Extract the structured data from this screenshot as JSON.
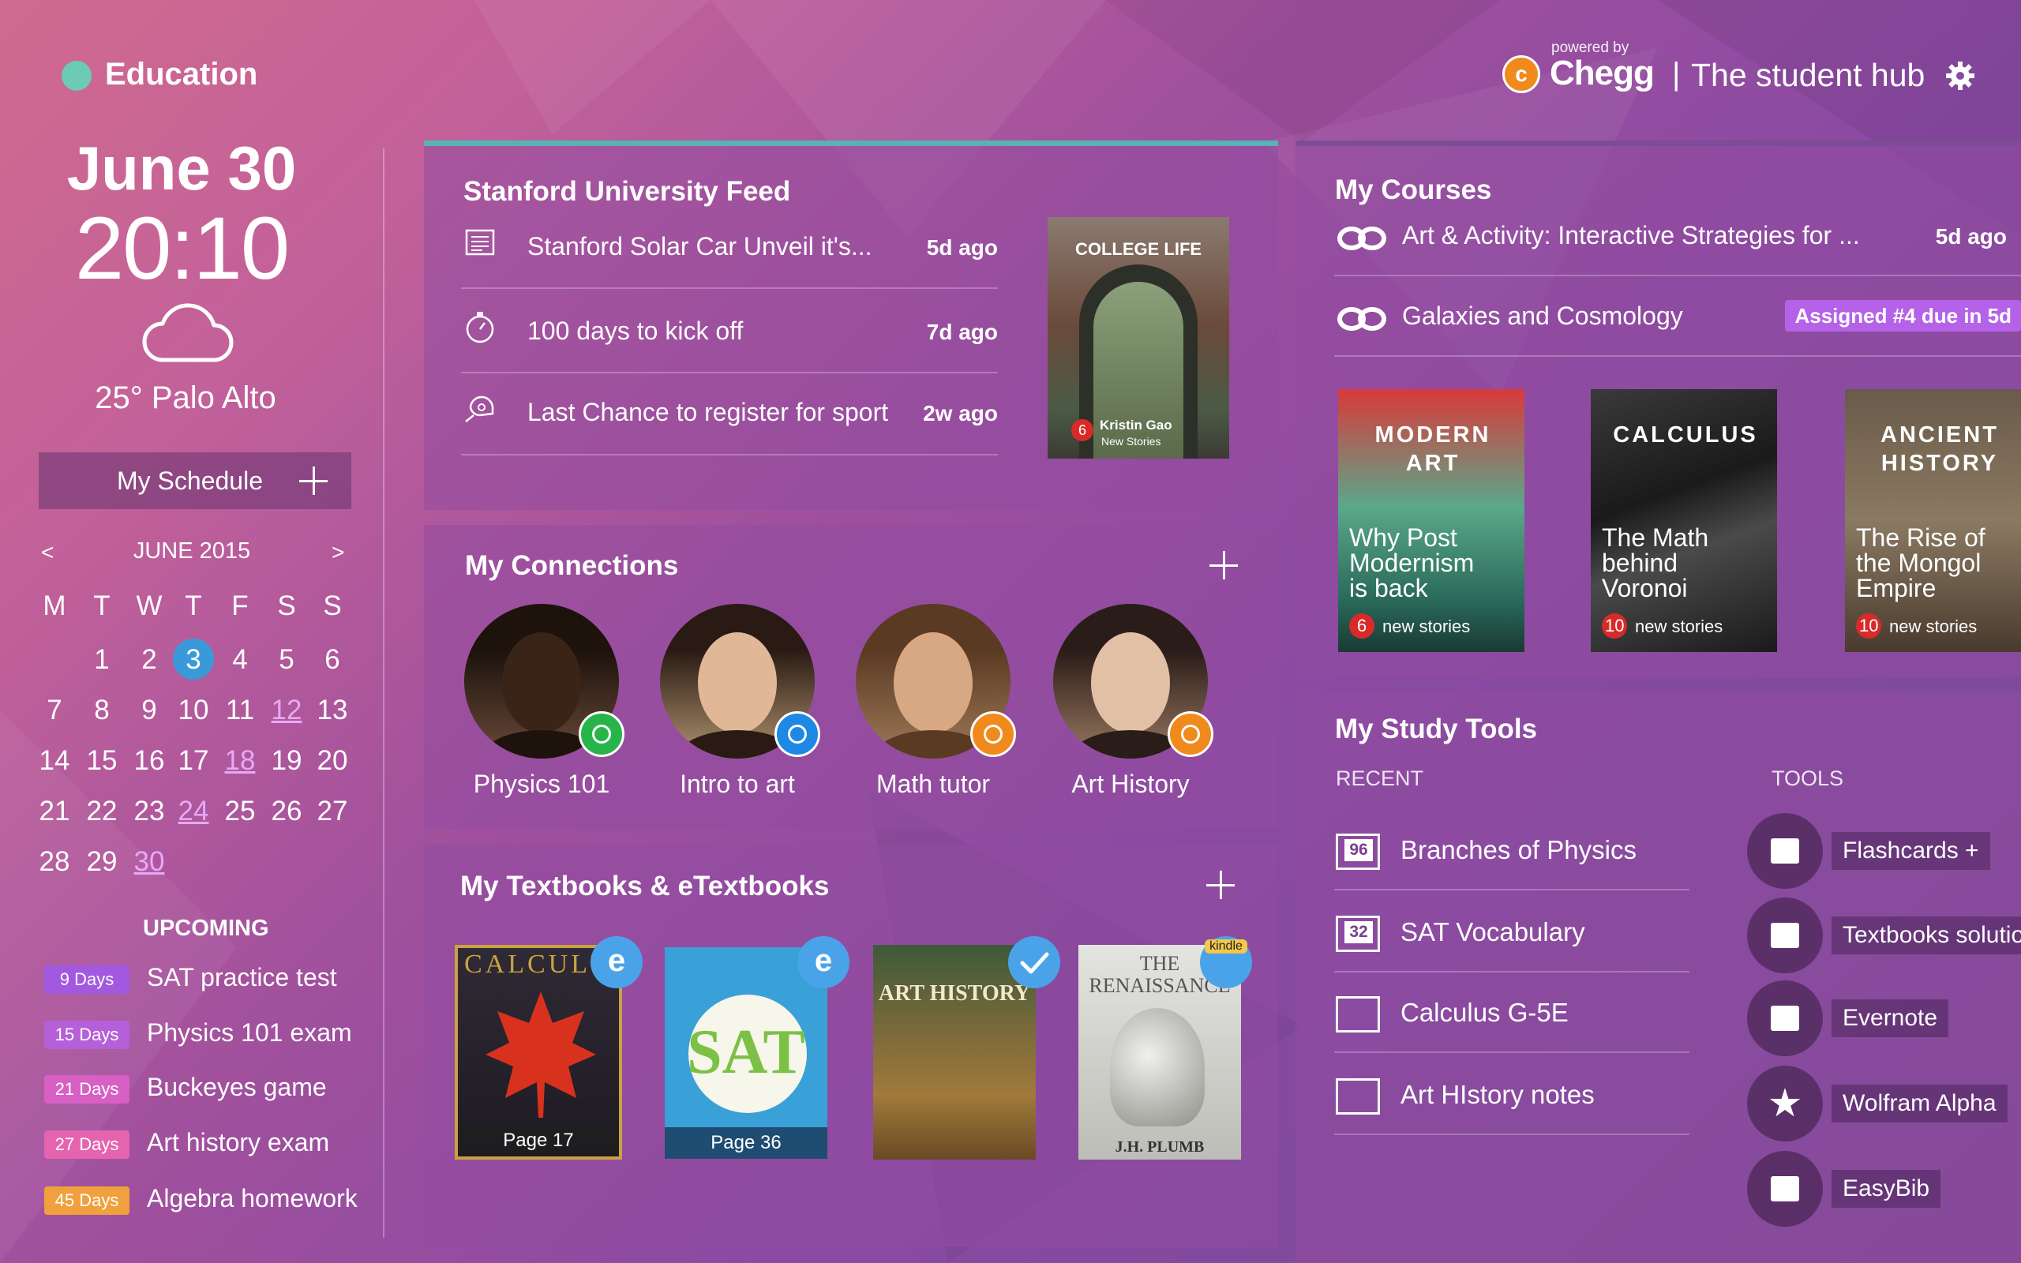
{
  "header": {
    "section_title": "Education",
    "powered_by": "powered by",
    "brand": "Chegg",
    "brand_tagline": "The student hub",
    "brand_mark": "c",
    "separator": "|"
  },
  "sidebar": {
    "date": "June 30",
    "time": "20:10",
    "weather": "25° Palo Alto",
    "schedule_button": "My Schedule",
    "calendar": {
      "prev": "<",
      "next": ">",
      "month": "JUNE 2015",
      "weekdays": [
        "M",
        "T",
        "W",
        "T",
        "F",
        "S",
        "S"
      ],
      "weeks": [
        [
          "",
          "1",
          "2",
          "3",
          "4",
          "5",
          "6"
        ],
        [
          "7",
          "8",
          "9",
          "10",
          "11",
          "12",
          "13"
        ],
        [
          "14",
          "15",
          "16",
          "17",
          "18",
          "19",
          "20"
        ],
        [
          "21",
          "22",
          "23",
          "24",
          "25",
          "26",
          "27"
        ],
        [
          "28",
          "29",
          "30",
          "",
          "",
          "",
          ""
        ]
      ]
    },
    "upcoming_title": "UPCOMING",
    "upcoming": [
      {
        "days": "9 Days",
        "label": "SAT practice test",
        "color": "#a259e0"
      },
      {
        "days": "15 Days",
        "label": "Physics 101 exam",
        "color": "#b560d8"
      },
      {
        "days": "21 Days",
        "label": "Buckeyes game",
        "color": "#d85fc4"
      },
      {
        "days": "27 Days",
        "label": "Art history exam",
        "color": "#e564b0"
      },
      {
        "days": "45 Days",
        "label": "Algebra homework",
        "color": "#f0a03c"
      }
    ]
  },
  "feed": {
    "title": "Stanford University Feed",
    "items": [
      {
        "icon": "newspaper-icon",
        "label": "Stanford Solar Car Unveil it's...",
        "time": "5d ago"
      },
      {
        "icon": "stopwatch-icon",
        "label": "100 days to kick off",
        "time": "7d ago"
      },
      {
        "icon": "whistle-icon",
        "label": "Last Chance to register for sport",
        "time": "2w ago"
      }
    ],
    "thumb": {
      "title": "COLLEGE LIFE",
      "count": "6",
      "name": "Kristin Gao",
      "sub": "New Stories"
    }
  },
  "connections": {
    "title": "My Connections",
    "people": [
      {
        "label": "Physics 101",
        "badge": "whatsapp-icon"
      },
      {
        "label": "Intro to art",
        "badge": "messenger-icon"
      },
      {
        "label": "Math tutor",
        "badge": "chegg-icon"
      },
      {
        "label": "Art History",
        "badge": "chegg-icon"
      }
    ]
  },
  "textbooks": {
    "title": "My Textbooks & eTextbooks",
    "badge_e": "e",
    "badge_kindle": "kindle",
    "books": [
      {
        "title": "CALCULUS",
        "page": "Page 17"
      },
      {
        "title": "SAT",
        "page": "Page 36"
      },
      {
        "title": "ART HISTORY",
        "page": ""
      },
      {
        "title": "THE RENAISSANCE",
        "author": "J.H. PLUMB",
        "page": ""
      }
    ]
  },
  "courses": {
    "title": "My Courses",
    "items": [
      {
        "label": "Art & Activity: Interactive Strategies for ...",
        "meta": "5d ago"
      },
      {
        "label": "Galaxies and Cosmology",
        "meta": "Assigned #4 due in 5d"
      }
    ],
    "cards": [
      {
        "title": "MODERN ART",
        "subtitle": "Why Post Modernism is back",
        "count": "6",
        "stories": "new stories"
      },
      {
        "title": "CALCULUS",
        "subtitle": "The Math behind Voronoi",
        "count": "10",
        "stories": "new stories"
      },
      {
        "title": "ANCIENT HISTORY",
        "subtitle": "The Rise of the Mongol Empire",
        "count": "10",
        "stories": "new stories"
      }
    ]
  },
  "study": {
    "title": "My Study Tools",
    "recent_label": "RECENT",
    "tools_label": "TOOLS",
    "recent": [
      {
        "badge": "96",
        "label": "Branches of Physics"
      },
      {
        "badge": "32",
        "label": "SAT Vocabulary"
      },
      {
        "badge": "",
        "label": "Calculus G-5E"
      },
      {
        "badge": "",
        "label": "Art HIstory notes"
      }
    ],
    "tools": [
      {
        "label": "Flashcards +",
        "icon": "flashcards-icon"
      },
      {
        "label": "Textbooks solutions",
        "icon": "textbook-solutions-icon"
      },
      {
        "label": "Evernote",
        "icon": "evernote-icon"
      },
      {
        "label": "Wolfram Alpha",
        "icon": "wolfram-icon"
      },
      {
        "label": "EasyBib",
        "icon": "easybib-icon"
      }
    ]
  }
}
